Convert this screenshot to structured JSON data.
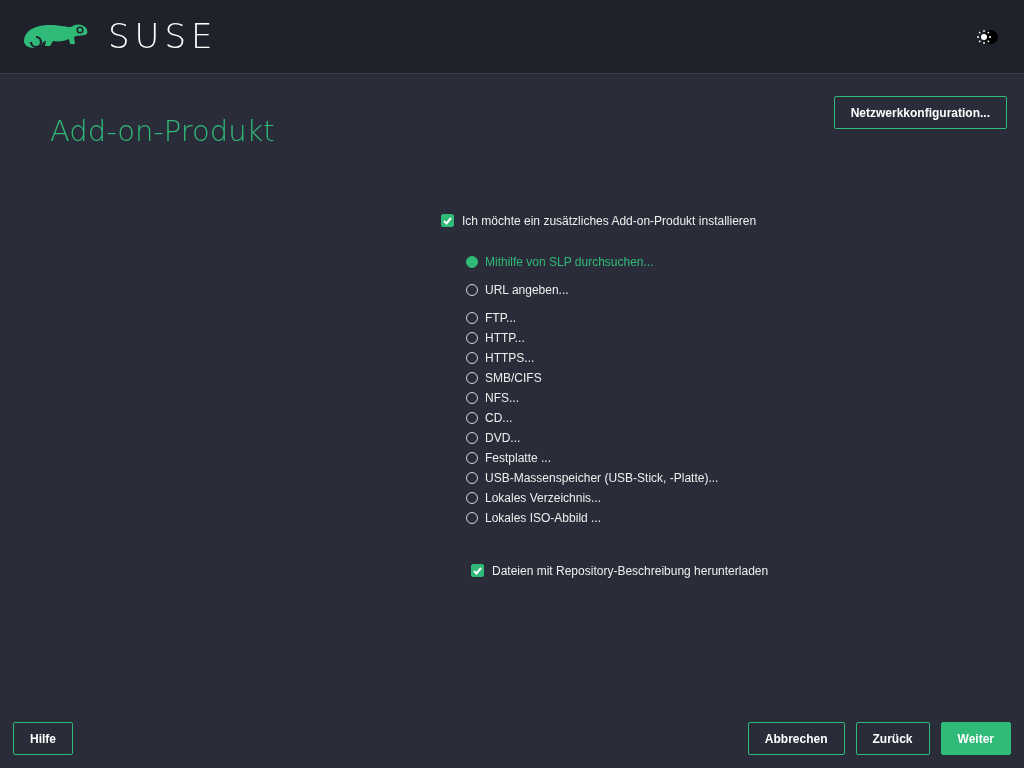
{
  "header": {
    "logo_text": "SUSE"
  },
  "title": "Add-on-Produkt",
  "network_button": "Netzwerkkonfiguration...",
  "addon_checkbox": {
    "label": "Ich möchte ein zusätzliches Add-on-Produkt installieren",
    "checked": true
  },
  "sources": [
    {
      "label": "Mithilfe von SLP durchsuchen...",
      "selected": true
    },
    {
      "label": "URL angeben...",
      "selected": false
    },
    {
      "label": "FTP...",
      "selected": false
    },
    {
      "label": "HTTP...",
      "selected": false
    },
    {
      "label": "HTTPS...",
      "selected": false
    },
    {
      "label": "SMB/CIFS",
      "selected": false
    },
    {
      "label": "NFS...",
      "selected": false
    },
    {
      "label": "CD...",
      "selected": false
    },
    {
      "label": "DVD...",
      "selected": false
    },
    {
      "label": "Festplatte ...",
      "selected": false
    },
    {
      "label": "USB-Massenspeicher (USB-Stick, -Platte)...",
      "selected": false
    },
    {
      "label": "Lokales Verzeichnis...",
      "selected": false
    },
    {
      "label": "Lokales ISO-Abbild ...",
      "selected": false
    }
  ],
  "download_checkbox": {
    "label": "Dateien mit Repository-Beschreibung herunterladen",
    "checked": true
  },
  "footer": {
    "help": "Hilfe",
    "buttons": [
      {
        "label": "Abbrechen",
        "kind": "outline"
      },
      {
        "label": "Zurück",
        "kind": "outline"
      },
      {
        "label": "Weiter",
        "kind": "primary"
      }
    ]
  }
}
